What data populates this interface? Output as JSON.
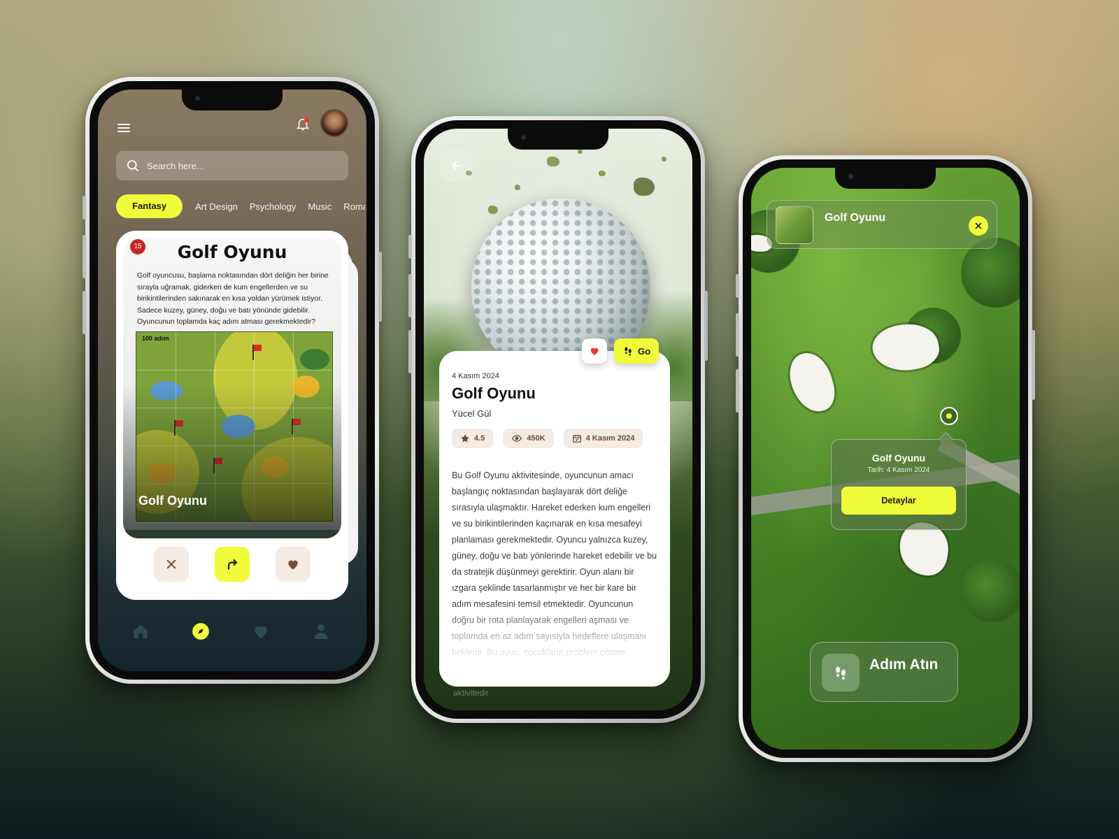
{
  "phone1": {
    "search": {
      "placeholder": "Search here..."
    },
    "categories": [
      "Fantasy",
      "Art Design",
      "Psychology",
      "Music",
      "Roma"
    ],
    "active_category": "Fantasy",
    "card": {
      "sheet_number": "15",
      "sheet_title": "Golf Oyunu",
      "sheet_text": "Golf oyuncusu, başlama noktasından dört deliğin her birine sırayla uğramak, giderken de kum engellerden ve su birikintilerinden sakınarak en kısa yoldan yürümek istiyor. Sadece kuzey, güney, doğu ve batı yönünde gidebilir. Oyuncunun toplamda kaç adım atması gerekmektedir?",
      "grid_label": "100 adım",
      "caption": "Golf Oyunu"
    },
    "actions": [
      "close-icon",
      "share-arrow-icon",
      "heart-icon"
    ],
    "tabbar": [
      "home-icon",
      "compass-icon",
      "heart-icon",
      "user-icon"
    ],
    "colors": {
      "accent": "#f0fb3a",
      "chip": "#f4ebe4",
      "chip_icon": "#7a4e30"
    }
  },
  "phone2": {
    "go_label": "Go",
    "date": "4 Kasım 2024",
    "title": "Golf Oyunu",
    "author": "Yücel Gül",
    "chips": [
      {
        "icon": "star-icon",
        "value": "4.5"
      },
      {
        "icon": "eye-icon",
        "value": "450K"
      },
      {
        "icon": "calendar-icon",
        "value": "4 Kasım 2024"
      }
    ],
    "description": "Bu Golf Oyunu aktivitesinde, oyuncunun amacı başlangıç noktasından başlayarak dört deliğe sırasıyla ulaşmaktır. Hareket ederken kum engelleri ve su birikintilerinden kaçınarak en kısa mesafeyi planlaması gerekmektedir. Oyuncu yalnızca kuzey, güney, doğu ve batı yönlerinde hareket edebilir ve bu da stratejik düşünmeyi gerektirir. Oyun alanı bir ızgara şeklinde tasarlanmıştır ve her bir kare bir adım mesafesini temsil etmektedir. Oyuncunun doğru bir rota planlayarak engelleri aşması ve toplamda en az adım sayısıyla hedeflere ulaşması beklenir. Bu oyun, çocukların problem çözme,",
    "bleed_text": "aktivitedir",
    "colors": {
      "heart": "#e53935",
      "accent": "#f0fb3a"
    }
  },
  "phone3": {
    "header_title": "Golf Oyunu",
    "popup": {
      "title": "Golf Oyunu",
      "date": "Tarih: 4 Kasım 2024",
      "button": "Detaylar"
    },
    "step_button": "Adım Atın"
  }
}
